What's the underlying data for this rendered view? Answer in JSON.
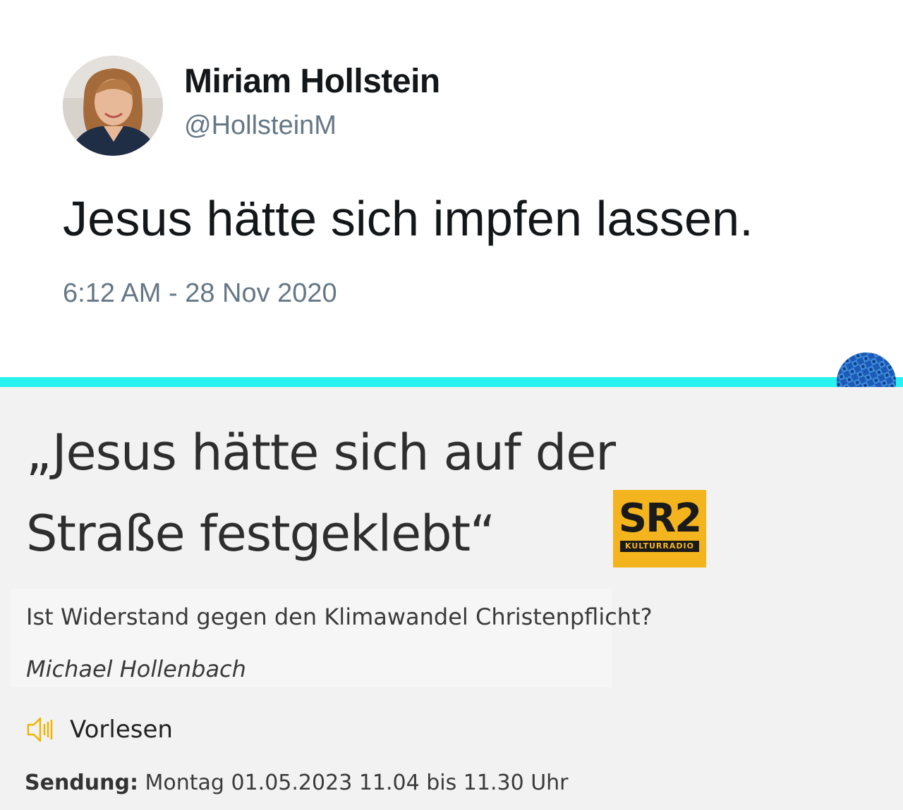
{
  "tweet": {
    "author_name": "Miriam Hollstein",
    "author_handle": "@HollsteinM",
    "text": "Jesus hätte sich impfen lassen.",
    "timestamp": "6:12 AM - 28 Nov 2020"
  },
  "colors": {
    "divider": "#27f3ee",
    "logo_bg": "#f4b41d",
    "speaker_icon": "#f0b400"
  },
  "article": {
    "headline_line1": "„Jesus hätte sich auf der",
    "headline_line2": "Straße festgeklebt“",
    "logo": {
      "main": "SR2",
      "sub": "KULTURRADIO"
    },
    "teaser": "Ist Widerstand gegen den Klimawandel Christenpflicht?",
    "author": "Michael Hollenbach",
    "read_aloud_label": "Vorlesen",
    "broadcast_label": "Sendung:",
    "broadcast_value": "Montag 01.05.2023 11.04 bis 11.30 Uhr"
  }
}
